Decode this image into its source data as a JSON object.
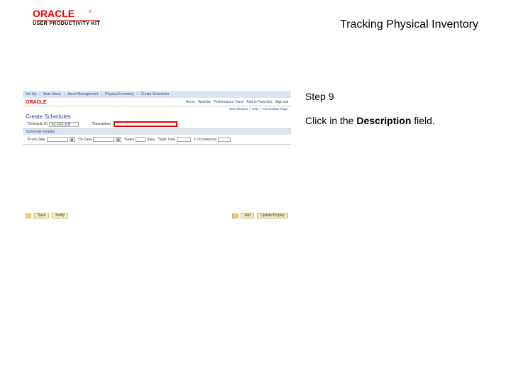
{
  "header": {
    "logo_text": "ORACLE",
    "product_line": "USER PRODUCTIVITY KIT",
    "title": "Tracking Physical Inventory"
  },
  "instruction": {
    "step_label": "Step 9",
    "line_prefix": "Click in the ",
    "line_bold": "Description",
    "line_suffix": " field."
  },
  "app": {
    "breadcrumb": {
      "items": [
        "Set Up",
        "Main Menu",
        "Asset Management",
        "Physical Inventory",
        "Create Schedules"
      ],
      "toolbar": [
        "Home",
        "Worklist",
        "Performance Trace",
        "Add to Favorites",
        "Sign out"
      ]
    },
    "rightlinks": [
      "New Window",
      "Help",
      "Personalize Page"
    ],
    "section_title": "Create Schedules",
    "row1": {
      "schedule_label": "*Schedule ID",
      "schedule_value": "SC-003-JLB",
      "description_label": "*Description"
    },
    "sub_header": "Schedule Details",
    "row2": {
      "from_label": "*From Date",
      "to_label": "*To Date",
      "every_label": "*Every",
      "days_label": "days",
      "start_label": "*Start Time",
      "occ_label": "# Occurrences"
    },
    "buttons": {
      "save": "Save",
      "notify": "Notify",
      "add": "Add",
      "update": "Update/Display"
    }
  }
}
